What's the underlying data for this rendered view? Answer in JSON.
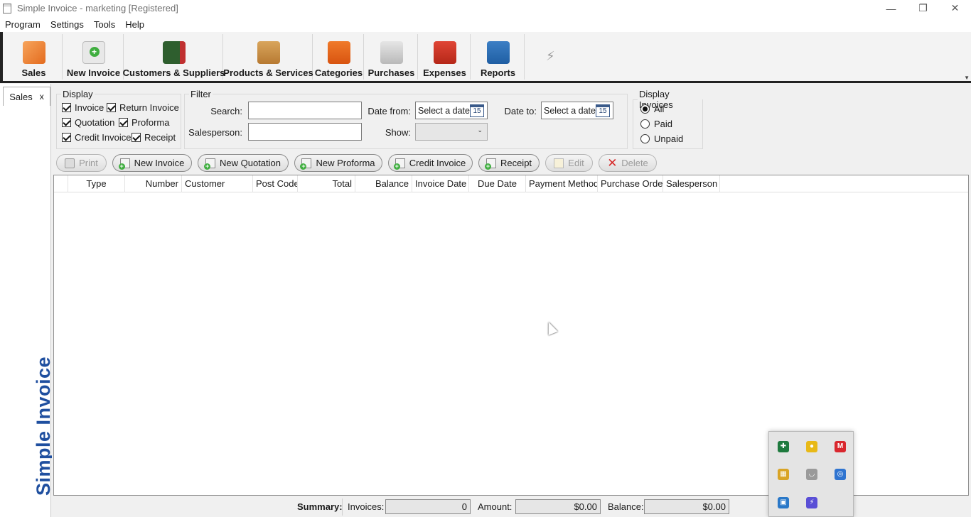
{
  "window": {
    "title": "Simple Invoice - marketing  [Registered]",
    "minimize": "—",
    "restore": "❐",
    "close": "✕"
  },
  "menu": [
    "Program",
    "Settings",
    "Tools",
    "Help"
  ],
  "ribbon": {
    "buttons": [
      {
        "label": "Sales",
        "icon": "sales-icon"
      },
      {
        "label": "New Invoice",
        "icon": "new-invoice-icon"
      },
      {
        "label": "Customers & Suppliers",
        "icon": "address-book-icon"
      },
      {
        "label": "Products & Services",
        "icon": "box-icon"
      },
      {
        "label": "Categories",
        "icon": "hierarchy-icon"
      },
      {
        "label": "Purchases",
        "icon": "cart-icon"
      },
      {
        "label": "Expenses",
        "icon": "coins-icon"
      },
      {
        "label": "Reports",
        "icon": "chart-icon"
      }
    ],
    "bolt": "⚡",
    "scroll": "▼"
  },
  "tab": {
    "label": "Sales",
    "close": "x"
  },
  "brand": "Simple Invoice",
  "display": {
    "legend": "Display",
    "items": [
      {
        "label": "Invoice",
        "checked": true
      },
      {
        "label": "Return Invoice",
        "checked": true
      },
      {
        "label": "Quotation",
        "checked": true
      },
      {
        "label": "Proforma",
        "checked": true
      },
      {
        "label": "Credit Invoice",
        "checked": true
      },
      {
        "label": "Receipt",
        "checked": true
      }
    ]
  },
  "filter": {
    "legend": "Filter",
    "search_label": "Search:",
    "search_value": "",
    "salesperson_label": "Salesperson:",
    "salesperson_value": "",
    "date_from_label": "Date from:",
    "date_from_placeholder": "Select a date",
    "date_to_label": "Date to:",
    "date_to_placeholder": "Select a date",
    "calendar_day": "15",
    "show_label": "Show:",
    "show_value": "",
    "dropdown_arrow": "⌄"
  },
  "display_invoices": {
    "legend": "Display Invoices",
    "options": [
      {
        "label": "All",
        "selected": true
      },
      {
        "label": "Paid",
        "selected": false
      },
      {
        "label": "Unpaid",
        "selected": false
      }
    ]
  },
  "actions": [
    {
      "label": "Print",
      "enabled": false,
      "icon": "printer-icon"
    },
    {
      "label": "New Invoice",
      "enabled": true,
      "icon": "new-document-icon"
    },
    {
      "label": "New Quotation",
      "enabled": true,
      "icon": "new-document-icon"
    },
    {
      "label": "New Proforma",
      "enabled": true,
      "icon": "new-document-icon"
    },
    {
      "label": "Credit Invoice",
      "enabled": true,
      "icon": "new-document-icon"
    },
    {
      "label": "Receipt",
      "enabled": true,
      "icon": "new-document-icon"
    },
    {
      "label": "Edit",
      "enabled": false,
      "icon": "edit-icon"
    },
    {
      "label": "Delete",
      "enabled": false,
      "icon": "delete-icon",
      "glyph": "✕"
    }
  ],
  "grid": {
    "columns": [
      "Type",
      "Number",
      "Customer",
      "Post Code",
      "Total",
      "Balance",
      "Invoice Date",
      "Due Date",
      "Payment Method",
      "Purchase Order",
      "Salesperson"
    ],
    "rows": []
  },
  "summary": {
    "label": "Summary:",
    "invoices_label": "Invoices:",
    "invoices_value": "0",
    "amount_label": "Amount:",
    "amount_value": "$0.00",
    "balance_label": "Balance:",
    "balance_value": "$0.00"
  },
  "tray": {
    "icons": [
      {
        "name": "shield-icon",
        "glyph": "✚",
        "color": "#1e7a3e"
      },
      {
        "name": "chrome-icon",
        "glyph": "●",
        "color": "#e8b917"
      },
      {
        "name": "mega-icon",
        "glyph": "M",
        "color": "#d9272e"
      },
      {
        "name": "app-tile-icon",
        "glyph": "▦",
        "color": "#d9a426"
      },
      {
        "name": "cup-icon",
        "glyph": "◡",
        "color": "#9a9a9a"
      },
      {
        "name": "ring-icon",
        "glyph": "◎",
        "color": "#2f74d0"
      },
      {
        "name": "network-icon",
        "glyph": "▣",
        "color": "#2a78c8"
      },
      {
        "name": "bolt-icon",
        "glyph": "⚡",
        "color": "#5a4fd6"
      }
    ]
  },
  "colors": {
    "brand": "#1f4f9f",
    "accent": "#3fae3f",
    "danger": "#d62a2a"
  }
}
